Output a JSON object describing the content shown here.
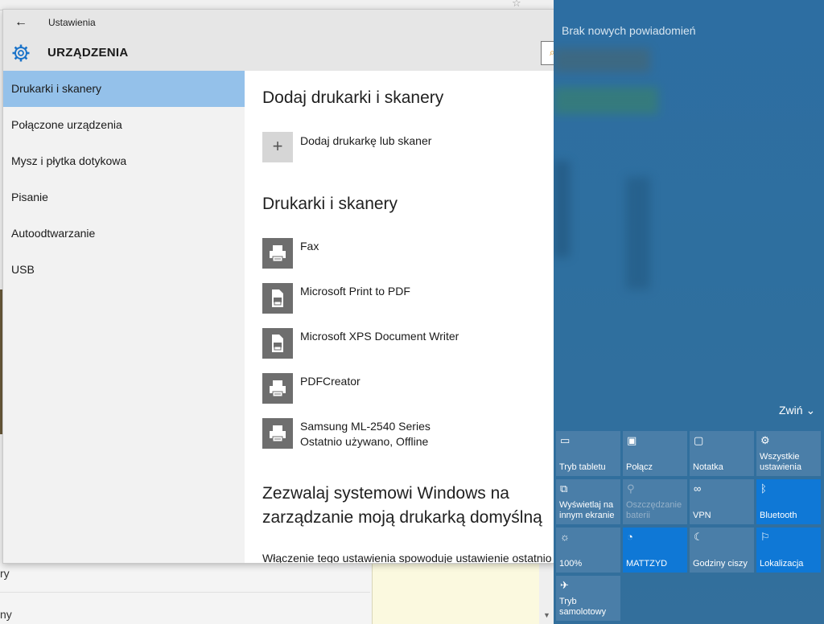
{
  "window": {
    "title": "Ustawienia",
    "section_title": "URZĄDZENIA"
  },
  "sidebar": {
    "items": [
      {
        "label": "Drukarki i skanery",
        "selected": true
      },
      {
        "label": "Połączone urządzenia"
      },
      {
        "label": "Mysz i płytka dotykowa"
      },
      {
        "label": "Pisanie"
      },
      {
        "label": "Autoodtwarzanie"
      },
      {
        "label": "USB"
      }
    ]
  },
  "main": {
    "add_heading": "Dodaj drukarki i skanery",
    "add_button_label": "Dodaj drukarkę lub skaner",
    "printers_heading": "Drukarki i skanery",
    "printers": [
      {
        "name": "Fax",
        "icon": "printer-icon"
      },
      {
        "name": "Microsoft Print to PDF",
        "icon": "document-printer-icon"
      },
      {
        "name": "Microsoft XPS Document Writer",
        "icon": "document-printer-icon"
      },
      {
        "name": "PDFCreator",
        "icon": "printer-icon"
      },
      {
        "name": "Samsung ML-2540 Series",
        "status": "Ostatnio używano, Offline",
        "icon": "printer-icon"
      }
    ],
    "default_heading_line1": "Zezwalaj systemowi Windows na",
    "default_heading_line2": "zarządzanie moją drukarką domyślną",
    "default_desc": "Włączenie tego ustawienia spowoduje ustawienie ostatnio"
  },
  "action_center": {
    "no_notifications": "Brak nowych powiadomień",
    "collapse_label": "Zwiń",
    "tiles": [
      {
        "label": "Tryb tabletu",
        "icon": "tablet-mode-icon",
        "active": false
      },
      {
        "label": "Połącz",
        "icon": "connect-icon",
        "active": false
      },
      {
        "label": "Notatka",
        "icon": "note-icon",
        "active": false
      },
      {
        "label": "Wszystkie ustawienia",
        "icon": "settings-icon",
        "active": false
      },
      {
        "label": "Wyświetlaj na innym ekranie",
        "icon": "project-icon",
        "active": false
      },
      {
        "label": "Oszczędzanie baterii",
        "icon": "battery-saver-icon",
        "active": false,
        "disabled": true
      },
      {
        "label": "VPN",
        "icon": "vpn-icon",
        "active": false
      },
      {
        "label": "Bluetooth",
        "icon": "bluetooth-icon",
        "active": true
      },
      {
        "label": "100%",
        "icon": "brightness-icon",
        "active": false
      },
      {
        "label": "MATTZYD",
        "icon": "wifi-icon",
        "active": true
      },
      {
        "label": "Godziny ciszy",
        "icon": "quiet-hours-icon",
        "active": false
      },
      {
        "label": "Lokalizacja",
        "icon": "location-icon",
        "active": true
      },
      {
        "label": "Tryb samolotowy",
        "icon": "airplane-icon",
        "active": false
      }
    ]
  },
  "background": {
    "text1": "ry",
    "text2": "ny"
  },
  "colors": {
    "accent": "#0f78d6",
    "sidebar_selected": "#94c1ea",
    "action_center_bg": "#2e6f9f"
  }
}
